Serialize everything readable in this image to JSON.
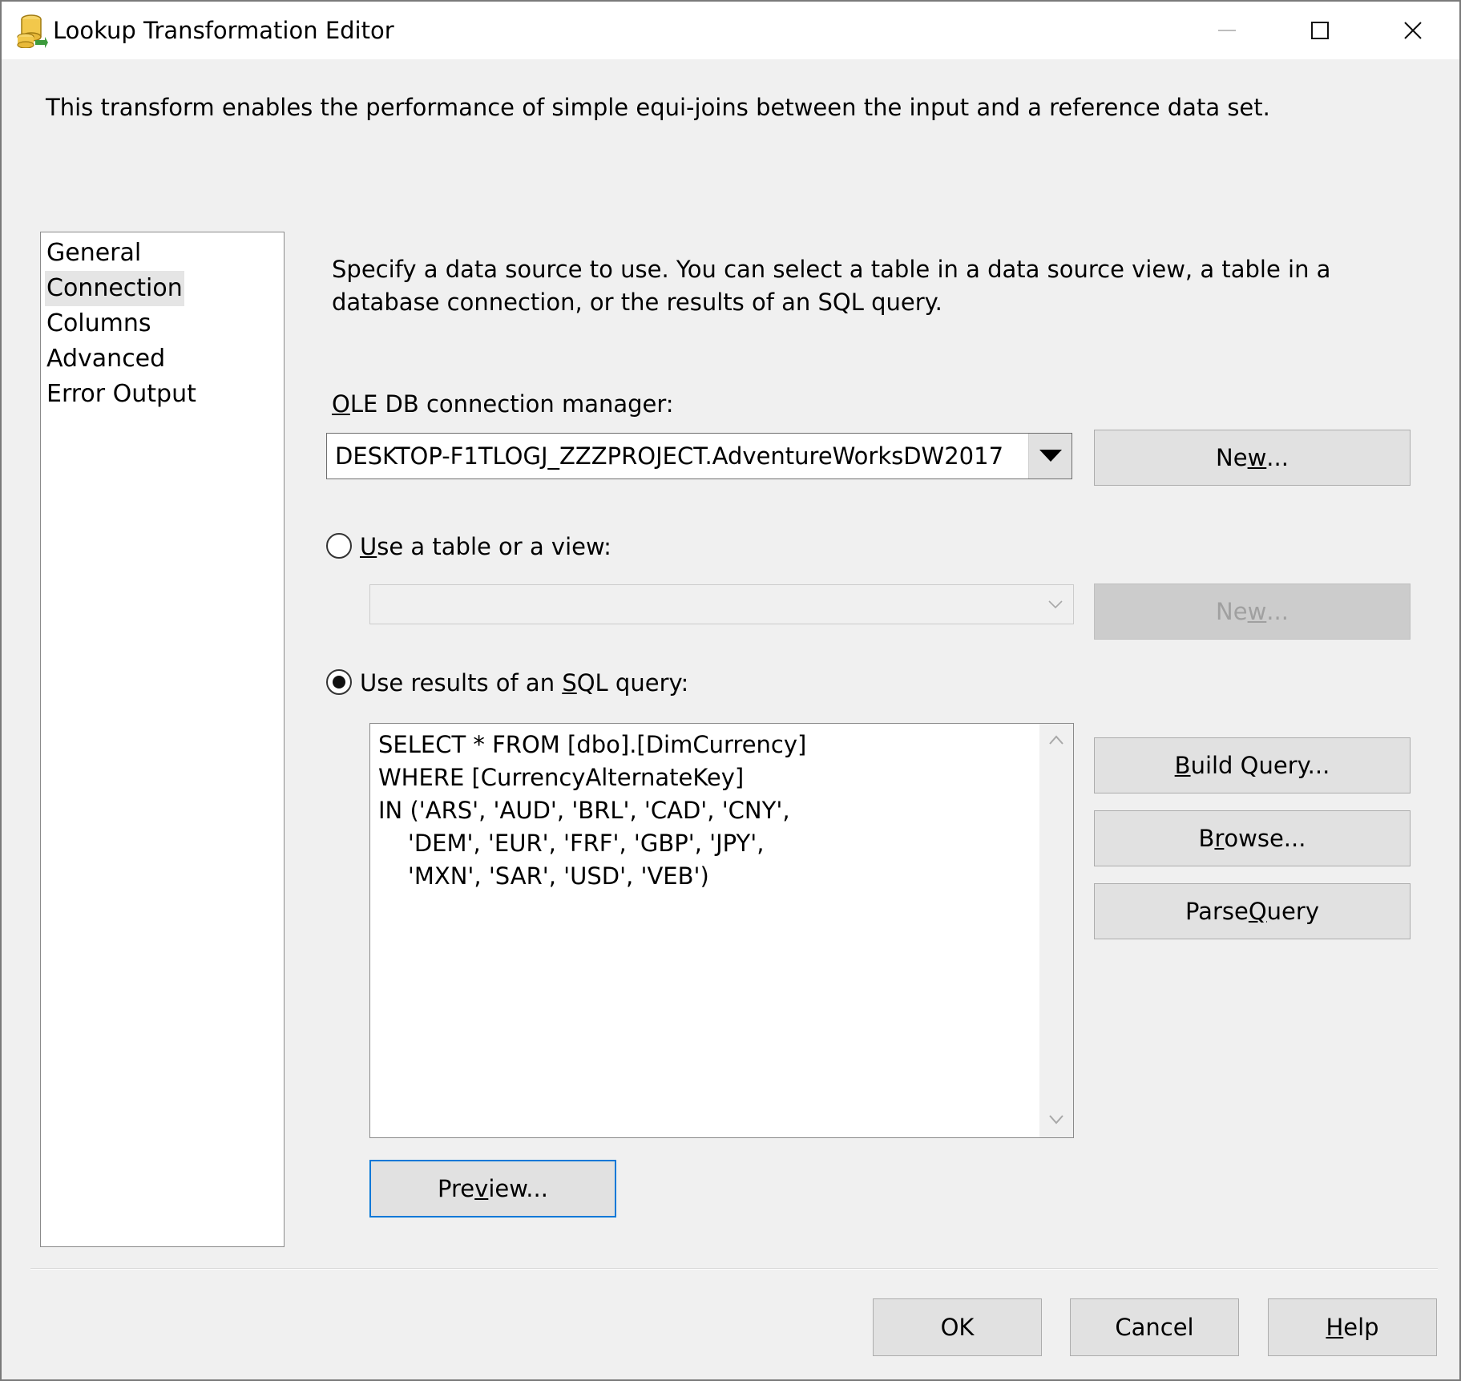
{
  "window": {
    "title": "Lookup Transformation Editor",
    "description": "This transform enables the performance of simple equi-joins between the input and a reference data set."
  },
  "nav": {
    "items": [
      {
        "label": "General",
        "selected": false
      },
      {
        "label": "Connection",
        "selected": true
      },
      {
        "label": "Columns",
        "selected": false
      },
      {
        "label": "Advanced",
        "selected": false
      },
      {
        "label": "Error Output",
        "selected": false
      }
    ]
  },
  "connection": {
    "instructions": "Specify a data source to use. You can select a table in a data source view, a table in a database connection, or the results of an SQL query.",
    "oledb_label_mnemonic": "O",
    "oledb_label_rest": "LE DB connection manager:",
    "oledb_value": "DESKTOP-F1TLOGJ_ZZZPROJECT.AdventureWorksDW2017",
    "new_button": {
      "pre": "Ne",
      "mn": "w",
      "post": "..."
    },
    "table_option": {
      "pre": "",
      "mn": "U",
      "post": "se a table or a view:",
      "selected": false
    },
    "table_value": "",
    "table_new_button": {
      "pre": "Ne",
      "mn": "w",
      "post": "..."
    },
    "sql_option": {
      "pre": "Use results of an ",
      "mn": "S",
      "post": "QL query:",
      "selected": true
    },
    "sql_lines": [
      "SELECT * FROM [dbo].[DimCurrency]",
      "WHERE [CurrencyAlternateKey]",
      "IN ('ARS', 'AUD', 'BRL', 'CAD', 'CNY',",
      "    'DEM', 'EUR', 'FRF', 'GBP', 'JPY',",
      "    'MXN', 'SAR', 'USD', 'VEB')"
    ],
    "build_query": {
      "pre": "",
      "mn": "B",
      "post": "uild Query..."
    },
    "browse": {
      "pre": "B",
      "mn": "r",
      "post": "owse..."
    },
    "parse_query": {
      "pre": "Parse ",
      "mn": "Q",
      "post": "uery"
    },
    "preview": {
      "pre": "Pre",
      "mn": "v",
      "post": "iew..."
    }
  },
  "footer": {
    "ok": "OK",
    "cancel": "Cancel",
    "help": {
      "pre": "",
      "mn": "H",
      "post": "elp"
    }
  },
  "colors": {
    "focus_border": "#0078d7",
    "background": "#f0f0f0"
  }
}
